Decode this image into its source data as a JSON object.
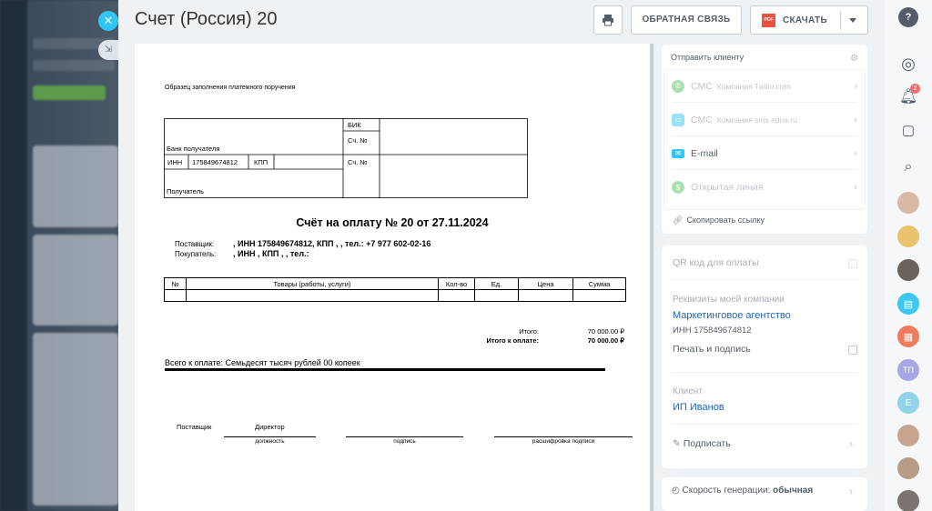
{
  "window": {
    "title": "Счет (Россия) 20"
  },
  "toolbar": {
    "feedback_label": "ОБРАТНАЯ СВЯЗЬ",
    "download_label": "СКАЧАТЬ",
    "pdf_badge": "PDF"
  },
  "document": {
    "sample_caption": "Образец заполнения платежного поручения",
    "bank": {
      "bik_label": "БИК",
      "account_label_1": "Сч. №",
      "account_label_2": "Сч. №",
      "bank_recipient_label": "Банк получателя",
      "inn_label": "ИНН",
      "inn_value": "175849674812",
      "kpp_label": "КПП",
      "recipient_label": "Получатель"
    },
    "invoice_title": "Счёт на оплату № 20 от 27.11.2024",
    "supplier_label": "Поставщик:",
    "supplier_value": ", ИНН 175849674812, КПП , , тел.: +7 977 602-02-16",
    "buyer_label": "Покупатель:",
    "buyer_value": ", ИНН , КПП , , тел.:",
    "goods_headers": [
      "№",
      "Товары (работы, услуги)",
      "Кол-во",
      "Ед.",
      "Цена",
      "Сумма"
    ],
    "total_label": "Итого:",
    "total_value": "70 000.00 ₽",
    "total_due_label": "Итого к оплате:",
    "total_due_value": "70 000.00 ₽",
    "total_words": "Всего к оплате: Семьдесят тысяч рублей 00 копеек",
    "signature": {
      "supplier_label": "Поставщик",
      "position_value": "Директор",
      "caption_position": "должность",
      "caption_signature": "подпись",
      "caption_decoding": "расшифровка подписи"
    }
  },
  "sidebar": {
    "send_header": "Отправить клиенту",
    "channels": [
      {
        "name": "СМС",
        "sub": "Компания Twilio.com"
      },
      {
        "name": "СМС",
        "sub": "Компания sms.edna.ru"
      },
      {
        "name": "E-mail",
        "sub": ""
      },
      {
        "name": "Открытая линия",
        "sub": ""
      }
    ],
    "copy_link": "Скопировать ссылку",
    "qr_label": "QR код для оплаты",
    "company_section_label": "Реквизиты моей компании",
    "company_name": "Маркетинговое агентство",
    "company_inn": "ИНН 175849674812",
    "print_sign_label": "Печать и подпись",
    "client_section_label": "Клиент",
    "client_name": "ИП Иванов",
    "sign_label": "Подписать",
    "speed_label": "Скорость генерации:",
    "speed_value": "обычная"
  },
  "rail": {
    "help": "?",
    "notifications_count": "2",
    "avatar_tp": "ТП",
    "avatar_e": "Е"
  },
  "colors": {
    "accent": "#2fc6f6",
    "link": "#2067b0",
    "pdf": "#e8523f",
    "whatsapp": "#55c361",
    "email": "#2fc6f6",
    "openline": "#55c361"
  }
}
